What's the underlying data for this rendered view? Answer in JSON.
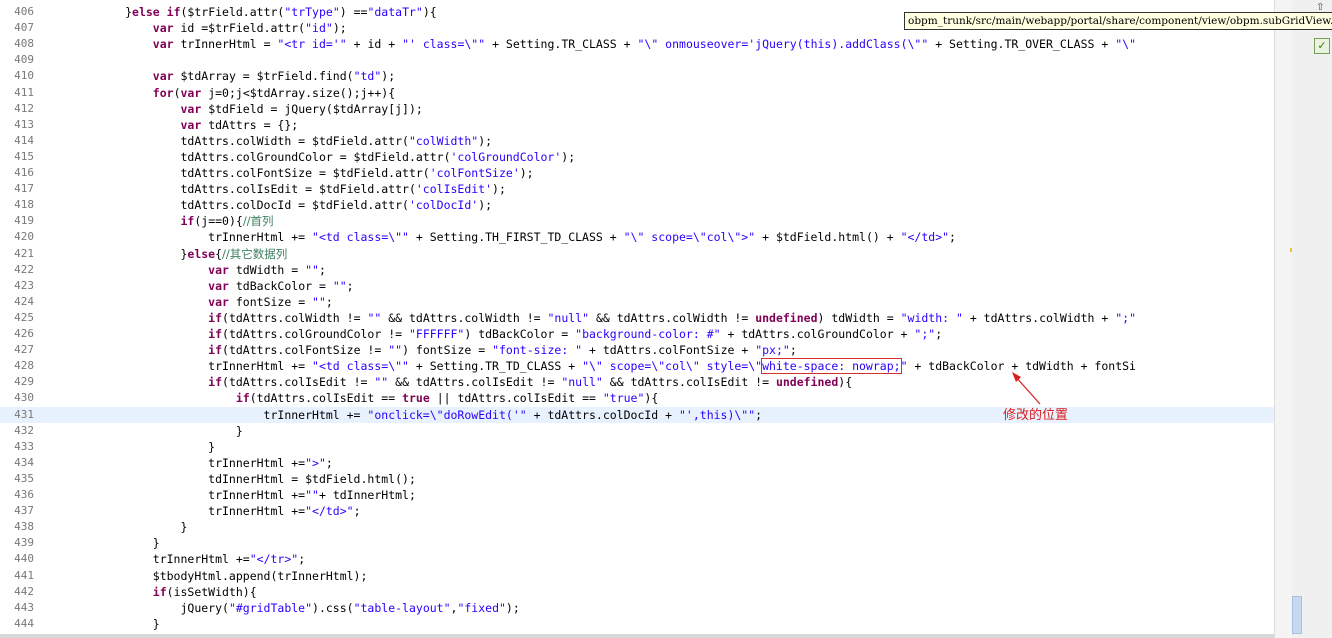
{
  "tooltip": {
    "path": "obpm_trunk/src/main/webapp/portal/share/component/view/obpm.subGridView.js"
  },
  "annotation": {
    "text": "修改的位置",
    "color": "#d81e1e"
  },
  "scrollbar": {
    "ok_mark": "✓",
    "up_mark": "⇧"
  },
  "colors": {
    "keyword": "#7f0055",
    "string": "#2a00ff",
    "comment": "#3f7f5f",
    "current_line": "#e8f2fe"
  },
  "lines": [
    {
      "n": "406",
      "t": [
        [
          "p",
          "            "
        ],
        [
          "p",
          "}"
        ],
        [
          "k",
          "else if"
        ],
        [
          "p",
          "($trField.attr("
        ],
        [
          "s",
          "\"trType\""
        ],
        [
          "p",
          ") =="
        ],
        [
          "s",
          "\"dataTr\""
        ],
        [
          "p",
          "){"
        ]
      ]
    },
    {
      "n": "407",
      "t": [
        [
          "p",
          "                "
        ],
        [
          "k",
          "var"
        ],
        [
          "p",
          " id =$trField.attr("
        ],
        [
          "s",
          "\"id\""
        ],
        [
          "p",
          ");"
        ]
      ]
    },
    {
      "n": "408",
      "t": [
        [
          "p",
          "                "
        ],
        [
          "k",
          "var"
        ],
        [
          "p",
          " trInnerHtml = "
        ],
        [
          "s",
          "\"<tr id='\""
        ],
        [
          "p",
          " + id + "
        ],
        [
          "s",
          "\"' class=\\\"\""
        ],
        [
          "p",
          " + Setting.TR_CLASS + "
        ],
        [
          "s",
          "\"\\\" onmouseover='jQuery(this).addClass(\\\"\""
        ],
        [
          "p",
          " + Setting.TR_OVER_CLASS + "
        ],
        [
          "s",
          "\"\\\""
        ]
      ]
    },
    {
      "n": "409",
      "t": []
    },
    {
      "n": "410",
      "t": [
        [
          "p",
          "                "
        ],
        [
          "k",
          "var"
        ],
        [
          "p",
          " $tdArray = $trField.find("
        ],
        [
          "s",
          "\"td\""
        ],
        [
          "p",
          ");"
        ]
      ]
    },
    {
      "n": "411",
      "t": [
        [
          "p",
          "                "
        ],
        [
          "k",
          "for"
        ],
        [
          "p",
          "("
        ],
        [
          "k",
          "var"
        ],
        [
          "p",
          " j=0;j<$tdArray.size();j++){"
        ]
      ]
    },
    {
      "n": "412",
      "t": [
        [
          "p",
          "                    "
        ],
        [
          "k",
          "var"
        ],
        [
          "p",
          " $tdField = jQuery($tdArray[j]);"
        ]
      ]
    },
    {
      "n": "413",
      "t": [
        [
          "p",
          "                    "
        ],
        [
          "k",
          "var"
        ],
        [
          "p",
          " tdAttrs = {};"
        ]
      ]
    },
    {
      "n": "414",
      "t": [
        [
          "p",
          "                    tdAttrs.colWidth = $tdField.attr("
        ],
        [
          "s",
          "\"colWidth\""
        ],
        [
          "p",
          ");"
        ]
      ]
    },
    {
      "n": "415",
      "t": [
        [
          "p",
          "                    tdAttrs.colGroundColor = $tdField.attr("
        ],
        [
          "s",
          "'colGroundColor'"
        ],
        [
          "p",
          ");"
        ]
      ]
    },
    {
      "n": "416",
      "t": [
        [
          "p",
          "                    tdAttrs.colFontSize = $tdField.attr("
        ],
        [
          "s",
          "'colFontSize'"
        ],
        [
          "p",
          ");"
        ]
      ]
    },
    {
      "n": "417",
      "t": [
        [
          "p",
          "                    tdAttrs.colIsEdit = $tdField.attr("
        ],
        [
          "s",
          "'colIsEdit'"
        ],
        [
          "p",
          ");"
        ]
      ]
    },
    {
      "n": "418",
      "t": [
        [
          "p",
          "                    tdAttrs.colDocId = $tdField.attr("
        ],
        [
          "s",
          "'colDocId'"
        ],
        [
          "p",
          ");"
        ]
      ]
    },
    {
      "n": "419",
      "t": [
        [
          "p",
          "                    "
        ],
        [
          "k",
          "if"
        ],
        [
          "p",
          "(j==0){"
        ],
        [
          "c",
          "//首列"
        ]
      ]
    },
    {
      "n": "420",
      "t": [
        [
          "p",
          "                        trInnerHtml += "
        ],
        [
          "s",
          "\"<td class=\\\"\""
        ],
        [
          "p",
          " + Setting.TH_FIRST_TD_CLASS + "
        ],
        [
          "s",
          "\"\\\" scope=\\\"col\\\">\""
        ],
        [
          "p",
          " + $tdField.html() + "
        ],
        [
          "s",
          "\"</td>\""
        ],
        [
          "p",
          ";"
        ]
      ]
    },
    {
      "n": "421",
      "t": [
        [
          "p",
          "                    }"
        ],
        [
          "k",
          "else"
        ],
        [
          "p",
          "{"
        ],
        [
          "c",
          "//其它数据列"
        ]
      ]
    },
    {
      "n": "422",
      "t": [
        [
          "p",
          "                        "
        ],
        [
          "k",
          "var"
        ],
        [
          "p",
          " tdWidth = "
        ],
        [
          "s",
          "\"\""
        ],
        [
          "p",
          ";"
        ]
      ]
    },
    {
      "n": "423",
      "t": [
        [
          "p",
          "                        "
        ],
        [
          "k",
          "var"
        ],
        [
          "p",
          " tdBackColor = "
        ],
        [
          "s",
          "\"\""
        ],
        [
          "p",
          ";"
        ]
      ]
    },
    {
      "n": "424",
      "t": [
        [
          "p",
          "                        "
        ],
        [
          "k",
          "var"
        ],
        [
          "p",
          " fontSize = "
        ],
        [
          "s",
          "\"\""
        ],
        [
          "p",
          ";"
        ]
      ]
    },
    {
      "n": "425",
      "t": [
        [
          "p",
          "                        "
        ],
        [
          "k",
          "if"
        ],
        [
          "p",
          "(tdAttrs.colWidth != "
        ],
        [
          "s",
          "\"\""
        ],
        [
          "p",
          " && tdAttrs.colWidth != "
        ],
        [
          "s",
          "\"null\""
        ],
        [
          "p",
          " && tdAttrs.colWidth != "
        ],
        [
          "k",
          "undefined"
        ],
        [
          "p",
          ") tdWidth = "
        ],
        [
          "s",
          "\"width: \""
        ],
        [
          "p",
          " + tdAttrs.colWidth + "
        ],
        [
          "s",
          "\";\""
        ]
      ]
    },
    {
      "n": "426",
      "t": [
        [
          "p",
          "                        "
        ],
        [
          "k",
          "if"
        ],
        [
          "p",
          "(tdAttrs.colGroundColor != "
        ],
        [
          "s",
          "\"FFFFFF\""
        ],
        [
          "p",
          ") tdBackColor = "
        ],
        [
          "s",
          "\"background-color: #\""
        ],
        [
          "p",
          " + tdAttrs.colGroundColor + "
        ],
        [
          "s",
          "\";\""
        ],
        [
          "p",
          ";"
        ]
      ]
    },
    {
      "n": "427",
      "t": [
        [
          "p",
          "                        "
        ],
        [
          "k",
          "if"
        ],
        [
          "p",
          "(tdAttrs.colFontSize != "
        ],
        [
          "s",
          "\"\""
        ],
        [
          "p",
          ") fontSize = "
        ],
        [
          "s",
          "\"font-size: \""
        ],
        [
          "p",
          " + tdAttrs.colFontSize + "
        ],
        [
          "s",
          "\"px;\""
        ],
        [
          "p",
          ";"
        ]
      ]
    },
    {
      "n": "428",
      "t": [
        [
          "p",
          "                        trInnerHtml += "
        ],
        [
          "s",
          "\"<td class=\\\"\""
        ],
        [
          "p",
          " + Setting.TR_TD_CLASS + "
        ],
        [
          "s",
          "\"\\\" scope=\\\"col\\\" style=\\\""
        ],
        [
          "h",
          "white-space: nowrap;"
        ],
        [
          "s",
          "\""
        ],
        [
          "p",
          " + tdBackColor + tdWidth + fontSi"
        ]
      ]
    },
    {
      "n": "429",
      "t": [
        [
          "p",
          "                        "
        ],
        [
          "k",
          "if"
        ],
        [
          "p",
          "(tdAttrs.colIsEdit != "
        ],
        [
          "s",
          "\"\""
        ],
        [
          "p",
          " && tdAttrs.colIsEdit != "
        ],
        [
          "s",
          "\"null\""
        ],
        [
          "p",
          " && tdAttrs.colIsEdit != "
        ],
        [
          "k",
          "undefined"
        ],
        [
          "p",
          "){"
        ]
      ]
    },
    {
      "n": "430",
      "t": [
        [
          "p",
          "                            "
        ],
        [
          "k",
          "if"
        ],
        [
          "p",
          "(tdAttrs.colIsEdit == "
        ],
        [
          "k",
          "true"
        ],
        [
          "p",
          " || tdAttrs.colIsEdit == "
        ],
        [
          "s",
          "\"true\""
        ],
        [
          "p",
          "){"
        ]
      ]
    },
    {
      "n": "431",
      "t": [
        [
          "p",
          "                                trInnerHtml += "
        ],
        [
          "s",
          "\"onclick=\\\"doRowEdit('\""
        ],
        [
          "p",
          " + tdAttrs.colDocId + "
        ],
        [
          "s",
          "\"',this)\\\"\""
        ],
        [
          "p",
          ";"
        ]
      ]
    },
    {
      "n": "432",
      "t": [
        [
          "p",
          "                            }"
        ]
      ]
    },
    {
      "n": "433",
      "t": [
        [
          "p",
          "                        }"
        ]
      ]
    },
    {
      "n": "434",
      "t": [
        [
          "p",
          "                        trInnerHtml +="
        ],
        [
          "s",
          "\">\""
        ],
        [
          "p",
          ";"
        ]
      ]
    },
    {
      "n": "435",
      "t": [
        [
          "p",
          "                        tdInnerHtml = $tdField.html();"
        ]
      ]
    },
    {
      "n": "436",
      "t": [
        [
          "p",
          "                        trInnerHtml +="
        ],
        [
          "s",
          "\"\""
        ],
        [
          "p",
          "+ tdInnerHtml;"
        ]
      ]
    },
    {
      "n": "437",
      "t": [
        [
          "p",
          "                        trInnerHtml +="
        ],
        [
          "s",
          "\"</td>\""
        ],
        [
          "p",
          ";"
        ]
      ]
    },
    {
      "n": "438",
      "t": [
        [
          "p",
          "                    }"
        ]
      ]
    },
    {
      "n": "439",
      "t": [
        [
          "p",
          "                }"
        ]
      ]
    },
    {
      "n": "440",
      "t": [
        [
          "p",
          "                trInnerHtml +="
        ],
        [
          "s",
          "\"</tr>\""
        ],
        [
          "p",
          ";"
        ]
      ]
    },
    {
      "n": "441",
      "t": [
        [
          "p",
          "                $tbodyHtml.append(trInnerHtml);"
        ]
      ]
    },
    {
      "n": "442",
      "t": [
        [
          "p",
          "                "
        ],
        [
          "k",
          "if"
        ],
        [
          "p",
          "(isSetWidth){"
        ]
      ]
    },
    {
      "n": "443",
      "t": [
        [
          "p",
          "                    jQuery("
        ],
        [
          "s",
          "\"#gridTable\""
        ],
        [
          "p",
          ").css("
        ],
        [
          "s",
          "\"table-layout\""
        ],
        [
          "p",
          ","
        ],
        [
          "s",
          "\"fixed\""
        ],
        [
          "p",
          ");"
        ]
      ]
    },
    {
      "n": "444",
      "t": [
        [
          "p",
          "                }"
        ]
      ]
    }
  ]
}
